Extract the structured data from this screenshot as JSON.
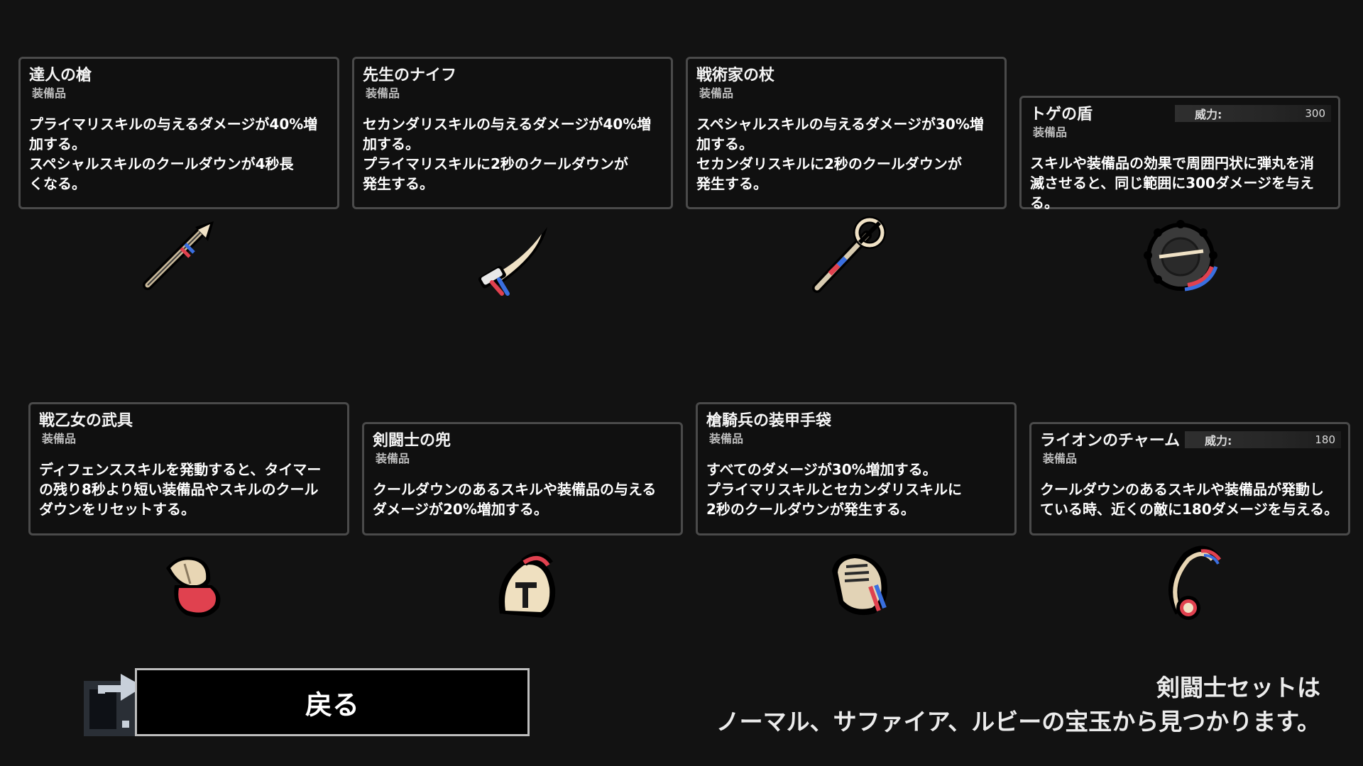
{
  "items": [
    {
      "id": "master-spear",
      "title": "達人の槍",
      "type": "装備品",
      "desc": "プライマリスキルの与えるダメージが40%増\n加する。\nスペシャルスキルのクールダウンが4秒長\nくなる。",
      "icon": "spear-icon"
    },
    {
      "id": "sensei-knife",
      "title": "先生のナイフ",
      "type": "装備品",
      "desc": "セカンダリスキルの与えるダメージが40%増\n加する。\nプライマリスキルに2秒のクールダウンが\n発生する。",
      "icon": "knife-icon"
    },
    {
      "id": "tactician-staff",
      "title": "戦術家の杖",
      "type": "装備品",
      "desc": "スペシャルスキルの与えるダメージが30%増\n加する。\nセカンダリスキルに2秒のクールダウンが\n発生する。",
      "icon": "staff-icon"
    },
    {
      "id": "spiked-shield",
      "title": "トゲの盾",
      "type": "装備品",
      "power_label": "威力:",
      "power_value": "300",
      "desc": "スキルや装備品の効果で周囲円状に弾丸を消\n滅させると、同じ範囲に300ダメージを与える。",
      "icon": "spiked-shield-icon"
    },
    {
      "id": "valkyrie-armor",
      "title": "戦乙女の武具",
      "type": "装備品",
      "desc": "ディフェンススキルを発動すると、タイマー\nの残り8秒より短い装備品やスキルのクール\nダウンをリセットする。",
      "icon": "armor-icon"
    },
    {
      "id": "gladiator-helmet",
      "title": "剣闘士の兜",
      "type": "装備品",
      "desc": "クールダウンのあるスキルや装備品の与える\nダメージが20%増加する。",
      "icon": "helmet-icon"
    },
    {
      "id": "lancer-gauntlet",
      "title": "槍騎兵の装甲手袋",
      "type": "装備品",
      "desc": "すべてのダメージが30%増加する。\nプライマリスキルとセカンダリスキルに\n2秒のクールダウンが発生する。",
      "icon": "gauntlet-icon"
    },
    {
      "id": "lion-charm",
      "title": "ライオンのチャーム",
      "type": "装備品",
      "power_label": "威力:",
      "power_value": "180",
      "desc": "クールダウンのあるスキルや装備品が発動し\nている時、近くの敵に180ダメージを与える。",
      "icon": "lion-charm-icon"
    }
  ],
  "back_button": {
    "label": "戻る",
    "icon": "back-arrow-icon"
  },
  "footer": {
    "line1": "剣闘士セットは",
    "line2": "ノーマル、サファイア、ルビーの宝玉から見つかります。"
  },
  "colors": {
    "background": "#121212",
    "card_border": "#4a4a4a",
    "accent_red": "#e0414f",
    "accent_blue": "#3a6fe0",
    "cream": "#f0e2c6"
  }
}
